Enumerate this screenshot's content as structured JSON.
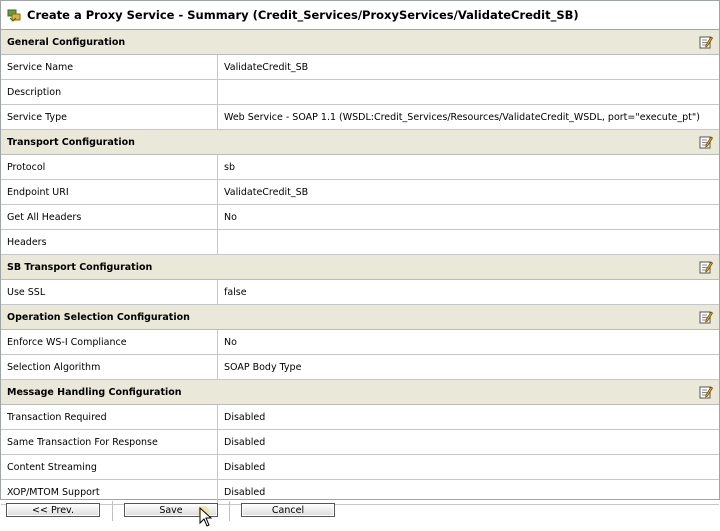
{
  "title": "Create a Proxy Service - Summary (Credit_Services/ProxyServices/ValidateCredit_SB)",
  "sections": [
    {
      "name": "General Configuration",
      "rows": [
        {
          "label": "Service Name",
          "value": "ValidateCredit_SB"
        },
        {
          "label": "Description",
          "value": ""
        },
        {
          "label": "Service Type",
          "value": "Web Service - SOAP 1.1 (WSDL:Credit_Services/Resources/ValidateCredit_WSDL, port=\"execute_pt\")"
        }
      ]
    },
    {
      "name": "Transport Configuration",
      "rows": [
        {
          "label": "Protocol",
          "value": "sb"
        },
        {
          "label": "Endpoint URI",
          "value": "ValidateCredit_SB"
        },
        {
          "label": "Get All Headers",
          "value": "No"
        },
        {
          "label": "Headers",
          "value": ""
        }
      ]
    },
    {
      "name": "SB Transport Configuration",
      "rows": [
        {
          "label": "Use SSL",
          "value": "false"
        }
      ]
    },
    {
      "name": "Operation Selection Configuration",
      "rows": [
        {
          "label": "Enforce WS-I Compliance",
          "value": "No"
        },
        {
          "label": "Selection Algorithm",
          "value": "SOAP Body Type"
        }
      ]
    },
    {
      "name": "Message Handling Configuration",
      "rows": [
        {
          "label": "Transaction Required",
          "value": "Disabled"
        },
        {
          "label": "Same Transaction For Response",
          "value": "Disabled"
        },
        {
          "label": "Content Streaming",
          "value": "Disabled"
        },
        {
          "label": "XOP/MTOM Support",
          "value": "Disabled"
        }
      ]
    }
  ],
  "buttons": {
    "prev": "<< Prev.",
    "save": "Save",
    "cancel": "Cancel"
  },
  "icons": {
    "title": "proxy-service-icon",
    "edit": "edit-icon"
  },
  "colors": {
    "section_header_bg": "#e9e8d9",
    "border": "#9fa5a5"
  }
}
